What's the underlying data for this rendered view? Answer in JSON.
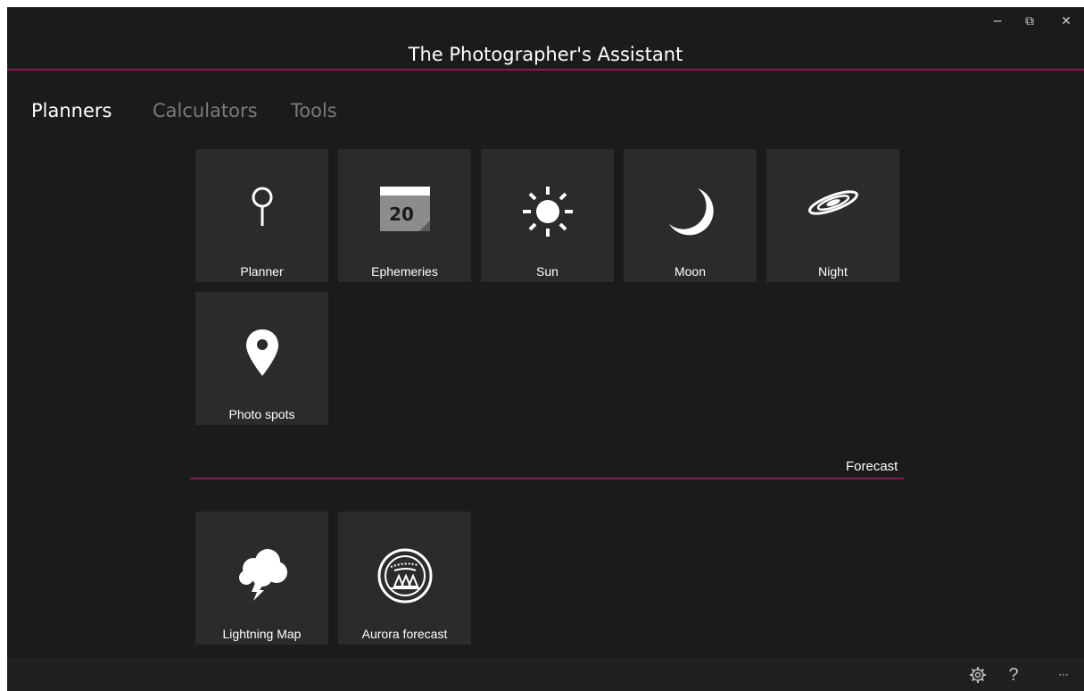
{
  "window": {
    "title": "The Photographer's Assistant",
    "controls": {
      "minimize": "−",
      "restore": "⧉",
      "close": "✕"
    }
  },
  "pivot": {
    "tabs": [
      {
        "label": "Planners",
        "active": true
      },
      {
        "label": "Calculators",
        "active": false
      },
      {
        "label": "Tools",
        "active": false
      }
    ]
  },
  "planners": {
    "tiles": [
      {
        "label": "Planner",
        "icon": "pin-outline-icon"
      },
      {
        "label": "Ephemeries",
        "icon": "calendar-icon",
        "icon_text": "20"
      },
      {
        "label": "Sun",
        "icon": "sun-icon"
      },
      {
        "label": "Moon",
        "icon": "moon-icon"
      },
      {
        "label": "Night",
        "icon": "galaxy-icon"
      },
      {
        "label": "Photo spots",
        "icon": "map-pin-icon"
      }
    ]
  },
  "forecast": {
    "header": "Forecast",
    "tiles": [
      {
        "label": "Lightning Map",
        "icon": "storm-cloud-icon"
      },
      {
        "label": "Aurora forecast",
        "icon": "aurora-icon"
      }
    ]
  },
  "bottom_bar": {
    "settings_icon": "gear-icon",
    "help_label": "?",
    "more_label": "···"
  },
  "colors": {
    "background": "#1b1b1b",
    "tile": "#2b2b2b",
    "accent": "#8a1a55",
    "inactive_text": "#7a7a7a"
  }
}
